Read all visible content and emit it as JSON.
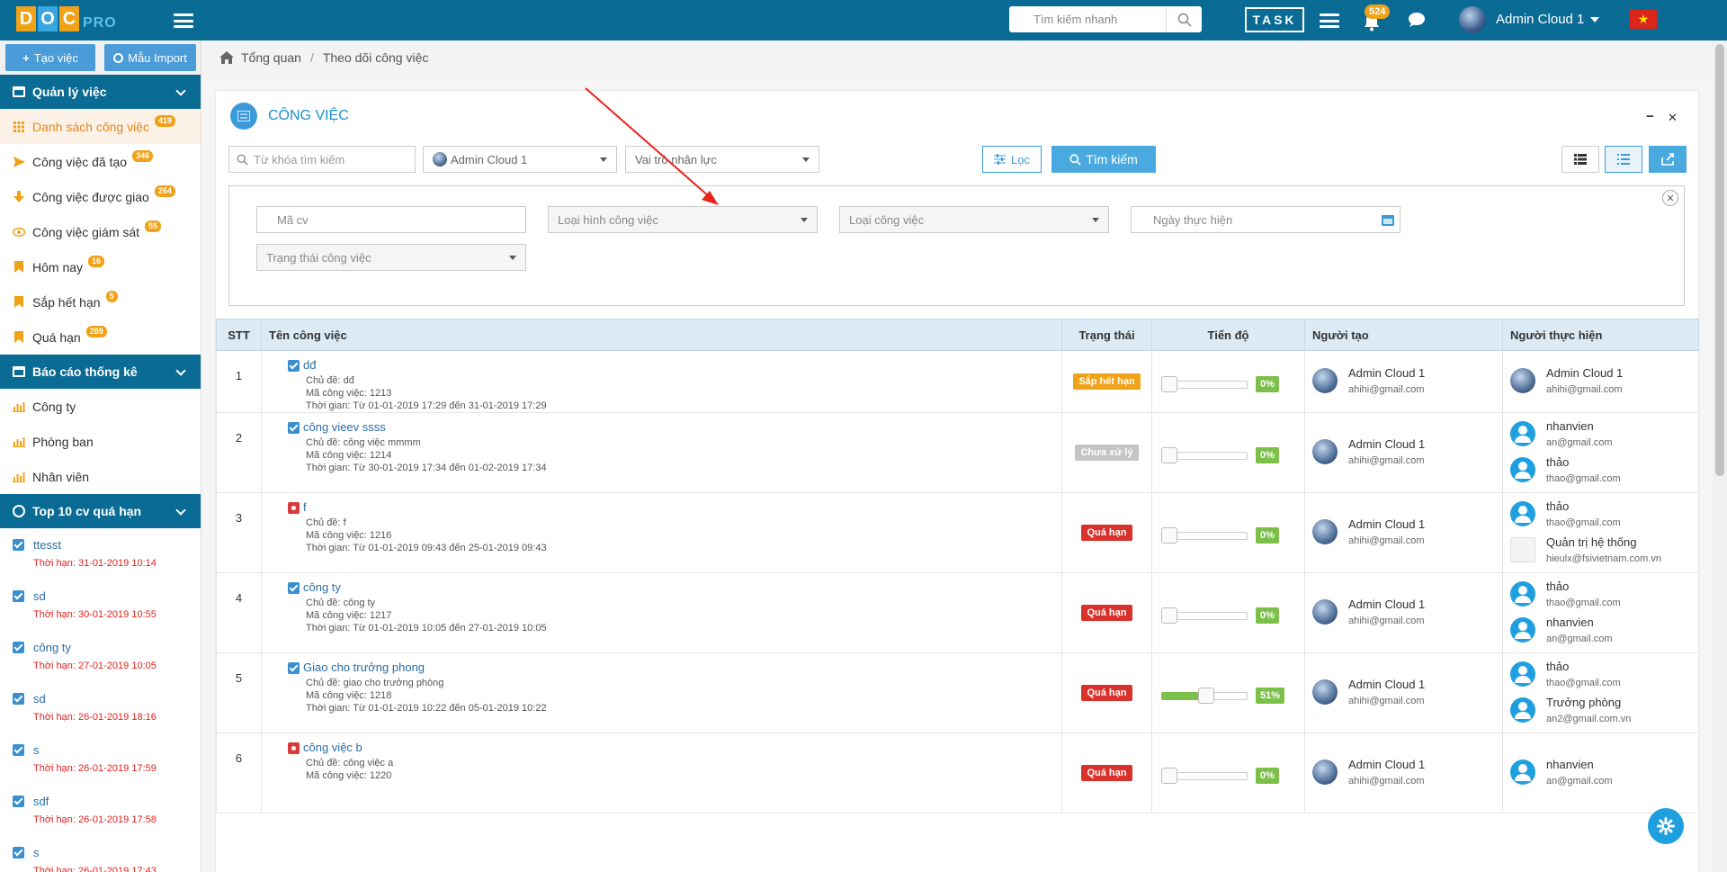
{
  "topbar": {
    "logo_letters": [
      "D",
      "O",
      "C"
    ],
    "logo_colors": [
      "#f0a218",
      "#3aa6e0",
      "#f0a218"
    ],
    "logo_suffix": "PRO",
    "search_placeholder": "Tìm kiếm nhanh",
    "task_label": "TASK",
    "notification_count": "524",
    "user_name": "Admin Cloud 1",
    "flag_star": "★"
  },
  "sidebar": {
    "create_button": "Tạo việc",
    "import_button": "Mẫu Import",
    "sections": [
      {
        "title": "Quản lý việc"
      },
      {
        "title": "Báo cáo thống kê"
      },
      {
        "title": "Top 10 cv quá hạn"
      }
    ],
    "task_items": [
      {
        "label": "Danh sách công việc",
        "count": "419",
        "icon": "list-icon"
      },
      {
        "label": "Công việc đã tạo",
        "count": "346",
        "icon": "send-icon"
      },
      {
        "label": "Công việc được giao",
        "count": "264",
        "icon": "arrow-down-icon"
      },
      {
        "label": "Công việc giám sát",
        "count": "55",
        "icon": "eye-icon"
      },
      {
        "label": "Hôm nay",
        "count": "16",
        "icon": "bookmark-icon"
      },
      {
        "label": "Sắp hết hạn",
        "count": "5",
        "icon": "bookmark-icon"
      },
      {
        "label": "Quá hạn",
        "count": "289",
        "icon": "bookmark-icon"
      }
    ],
    "report_items": [
      {
        "label": "Công ty"
      },
      {
        "label": "Phòng ban"
      },
      {
        "label": "Nhân viên"
      }
    ],
    "top_overdue": [
      {
        "name": "ttesst",
        "due": "Thời hạn: 31-01-2019 10:14"
      },
      {
        "name": "sd",
        "due": "Thời hạn: 30-01-2019 10:55"
      },
      {
        "name": "công ty",
        "due": "Thời hạn: 27-01-2019 10:05"
      },
      {
        "name": "sd",
        "due": "Thời hạn: 26-01-2019 18:16"
      },
      {
        "name": "s",
        "due": "Thời hạn: 26-01-2019 17:59"
      },
      {
        "name": "sdf",
        "due": "Thời hạn: 26-01-2019 17:58"
      },
      {
        "name": "s",
        "due": "Thời hạn: 26-01-2019 17:43"
      }
    ]
  },
  "breadcrumb": {
    "home": "Tổng quan",
    "separator": "/",
    "current": "Theo dõi công việc"
  },
  "panel": {
    "title": "CÔNG VIỆC",
    "minimize": "−",
    "close": "✕",
    "filters": {
      "keyword_placeholder": "Từ khóa tìm kiếm",
      "user_select": "Admin Cloud 1",
      "role_select": "Vai trò nhân lực",
      "filter_button": "Lọc",
      "search_button": "Tìm kiếm"
    },
    "advanced": {
      "code_placeholder": "Mã cv",
      "form_type": "Loại hình công việc",
      "task_type": "Loại công việc",
      "date_placeholder": "Ngày thực hiện",
      "status": "Trạng thái công việc",
      "close": "✕"
    }
  },
  "table": {
    "headers": [
      "STT",
      "Tên công việc",
      "Trạng thái",
      "Tiến độ",
      "Người tạo",
      "Người thực hiện"
    ],
    "rows": [
      {
        "stt": "1",
        "checked": true,
        "name": "dđ",
        "topic": "Chủ đề: dđ",
        "code": "Mã công việc: 1213",
        "time": "Thời gian: Từ 01-01-2019 17:29 đến 31-01-2019 17:29",
        "status": "Sắp hết hạn",
        "status_color": "#f0a218",
        "progress": 0,
        "progress_label": "0%",
        "creator": {
          "name": "Admin Cloud 1",
          "email": "ahihi@gmail.com"
        },
        "assignees": [
          {
            "name": "Admin Cloud 1",
            "email": "ahihi@gmail.com",
            "avatar": "globe"
          }
        ]
      },
      {
        "stt": "2",
        "checked": true,
        "name": "công vieev ssss",
        "topic": "Chủ đề: công việc mmmm",
        "code": "Mã công việc: 1214",
        "time": "Thời gian: Từ 30-01-2019 17:34 đến 01-02-2019 17:34",
        "status": "Chưa xử lý",
        "status_color": "#c4c4c4",
        "progress": 0,
        "progress_label": "0%",
        "creator": {
          "name": "Admin Cloud 1",
          "email": "ahihi@gmail.com"
        },
        "assignees": [
          {
            "name": "nhanvien",
            "email": "an@gmail.com",
            "avatar": "user"
          },
          {
            "name": "thảo",
            "email": "thao@gmail.com",
            "avatar": "user"
          }
        ]
      },
      {
        "stt": "3",
        "checked": false,
        "name": "f",
        "topic": "Chủ đề: f",
        "code": "Mã công việc: 1216",
        "time": "Thời gian: Từ 01-01-2019 09:43 đến 25-01-2019 09:43",
        "status": "Quá hạn",
        "status_color": "#d9322c",
        "progress": 0,
        "progress_label": "0%",
        "creator": {
          "name": "Admin Cloud 1",
          "email": "ahihi@gmail.com"
        },
        "assignees": [
          {
            "name": "thảo",
            "email": "thao@gmail.com",
            "avatar": "user"
          },
          {
            "name": "Quản trị hệ thống",
            "email": "hieulx@fsivietnam.com.vn",
            "avatar": "broken"
          }
        ]
      },
      {
        "stt": "4",
        "checked": true,
        "name": "công ty",
        "topic": "Chủ đề: công ty",
        "code": "Mã công việc: 1217",
        "time": "Thời gian: Từ 01-01-2019 10:05 đến 27-01-2019 10:05",
        "status": "Quá hạn",
        "status_color": "#d9322c",
        "progress": 0,
        "progress_label": "0%",
        "creator": {
          "name": "Admin Cloud 1",
          "email": "ahihi@gmail.com"
        },
        "assignees": [
          {
            "name": "thảo",
            "email": "thao@gmail.com",
            "avatar": "user"
          },
          {
            "name": "nhanvien",
            "email": "an@gmail.com",
            "avatar": "user"
          }
        ]
      },
      {
        "stt": "5",
        "checked": true,
        "name": "Giao cho trưởng phong",
        "topic": "Chủ đề: giao cho trưởng phòng",
        "code": "Mã công việc: 1218",
        "time": "Thời gian: Từ 01-01-2019 10:22 đến 05-01-2019 10:22",
        "status": "Quá hạn",
        "status_color": "#d9322c",
        "progress": 51,
        "progress_label": "51%",
        "creator": {
          "name": "Admin Cloud 1",
          "email": "ahihi@gmail.com"
        },
        "assignees": [
          {
            "name": "thảo",
            "email": "thao@gmail.com",
            "avatar": "user"
          },
          {
            "name": "Trưởng phòng",
            "email": "an2@gmail.com.vn",
            "avatar": "user"
          }
        ]
      },
      {
        "stt": "6",
        "checked": false,
        "name": "công việc b",
        "topic": "Chủ đề: công việc a",
        "code": "Mã công việc: 1220",
        "time": "",
        "status": "Quá hạn",
        "status_color": "#d9322c",
        "progress": 0,
        "progress_label": "0%",
        "creator": {
          "name": "Admin Cloud 1",
          "email": "ahihi@gmail.com"
        },
        "assignees": [
          {
            "name": "nhanvien",
            "email": "an@gmail.com",
            "avatar": "user"
          }
        ]
      }
    ]
  }
}
